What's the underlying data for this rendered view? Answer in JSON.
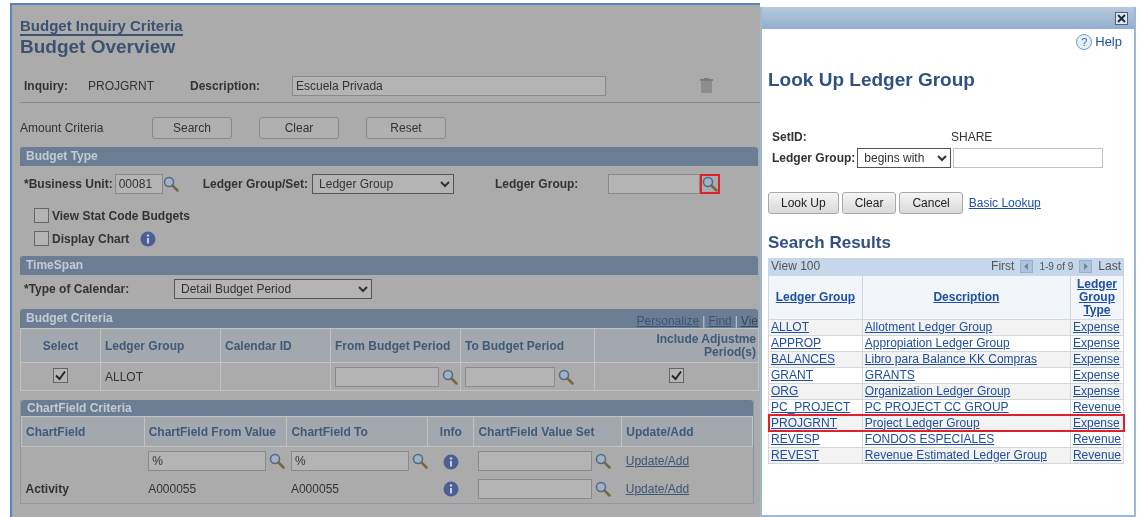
{
  "page": {
    "breadcrumb": "Budget Inquiry Criteria",
    "title": "Budget Overview",
    "inquiry": {
      "label": "Inquiry:",
      "value": "PROJGRNT"
    },
    "description": {
      "label": "Description:",
      "value": "Escuela Privada"
    },
    "amount_criteria": "Amount Criteria",
    "buttons": [
      "Search",
      "Clear",
      "Reset"
    ],
    "budget_type": {
      "title": "Budget Type",
      "business_unit_label": "*Business Unit:",
      "business_unit": "00081",
      "ledger_group_set_label": "Ledger Group/Set:",
      "ledger_group_set": "Ledger Group",
      "ledger_group_label": "Ledger Group:",
      "lookup_highlighted": true,
      "checkboxes": [
        {
          "label": "View Stat Code Budgets",
          "checked": false,
          "info": false
        },
        {
          "label": "Display Chart",
          "checked": false,
          "info": true
        }
      ]
    },
    "timespan": {
      "title": "TimeSpan",
      "calendar_label": "*Type of Calendar:",
      "calendar": "Detail Budget Period"
    },
    "budget_criteria": {
      "title": "Budget Criteria",
      "links": [
        "Personalize",
        "Find",
        "Vie"
      ],
      "link_separator": "|",
      "columns": [
        "Select",
        "Ledger Group",
        "Calendar ID",
        "From Budget Period",
        "To Budget Period",
        "Include Adjustme Period(s)"
      ],
      "rows": [
        {
          "selected": true,
          "ledger_group": "ALLOT",
          "include_adjustment": true
        }
      ]
    },
    "chartfield_criteria": {
      "title": "ChartField Criteria",
      "columns": [
        "ChartField",
        "ChartField From Value",
        "ChartField To",
        "Info",
        "ChartField Value Set",
        "Update/Add"
      ],
      "rows": [
        {
          "kind": "input",
          "from": "%",
          "to": "%",
          "link": "Update/Add"
        },
        {
          "kind": "text",
          "chartfield": "Activity",
          "from": "A000055",
          "to": "A000055",
          "link": "Update/Add"
        }
      ]
    }
  },
  "dialog": {
    "help": {
      "icon": "?",
      "label": "Help"
    },
    "title": "Look Up Ledger Group",
    "setid": {
      "label": "SetID:",
      "value": "SHARE"
    },
    "ledger_group": {
      "label": "Ledger Group:",
      "operator": "begins with"
    },
    "buttons": [
      "Look Up",
      "Clear",
      "Cancel"
    ],
    "basic_lookup": "Basic Lookup",
    "results_title": "Search Results",
    "pager": {
      "view": "View 100",
      "first": "First",
      "range": "1-9 of 9",
      "last": "Last"
    },
    "columns": [
      "Ledger Group",
      "Description",
      "Ledger Group Type"
    ],
    "rows": [
      {
        "ledger_group": "ALLOT",
        "description": "Allotment Ledger Group",
        "type": "Expense",
        "highlighted": false
      },
      {
        "ledger_group": "APPROP",
        "description": "Appropiation Ledger Group",
        "type": "Expense",
        "highlighted": false
      },
      {
        "ledger_group": "BALANCES",
        "description": "Libro para Balance KK Compras",
        "type": "Expense",
        "highlighted": false
      },
      {
        "ledger_group": "GRANT",
        "description": "GRANTS",
        "type": "Expense",
        "highlighted": false
      },
      {
        "ledger_group": "ORG",
        "description": "Organization Ledger Group",
        "type": "Expense",
        "highlighted": false
      },
      {
        "ledger_group": "PC_PROJECT",
        "description": "PC PROJECT CC GROUP",
        "type": "Revenue",
        "highlighted": false
      },
      {
        "ledger_group": "PROJGRNT",
        "description": "Project Ledger Group",
        "type": "Expense",
        "highlighted": true
      },
      {
        "ledger_group": "REVESP",
        "description": "FONDOS ESPECIALES",
        "type": "Revenue",
        "highlighted": false
      },
      {
        "ledger_group": "REVEST",
        "description": "Revenue Estimated Ledger Group",
        "type": "Revenue",
        "highlighted": false
      }
    ]
  }
}
